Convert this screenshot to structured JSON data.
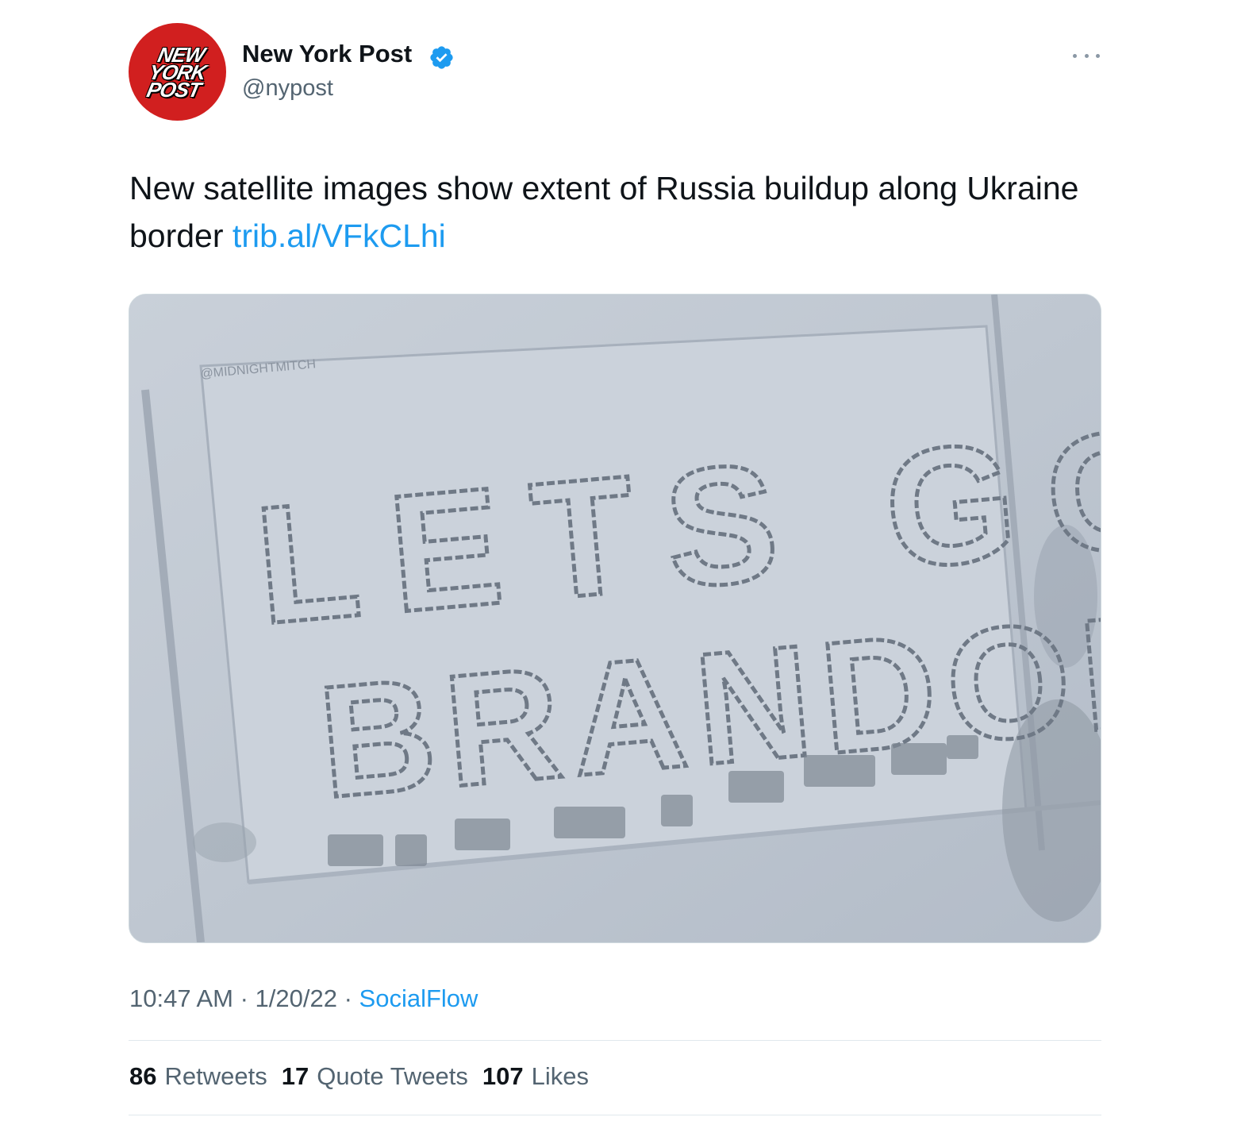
{
  "author": {
    "name": "New York Post",
    "handle": "@nypost",
    "verified": true,
    "avatar_logo_lines": [
      "NEW",
      "YORK",
      "POST"
    ],
    "avatar_color": "#d11f1f"
  },
  "tweet": {
    "text": "New satellite images show extent of Russia buildup along Ukraine border ",
    "link": "trib.al/VFkCLhi"
  },
  "media": {
    "watermark": "@MIDNIGHTMITCH",
    "vehicle_text_line_1": "LETS GO",
    "vehicle_text_line_2": "BRANDON"
  },
  "meta": {
    "time": "10:47 AM",
    "sep1": " · ",
    "date": "1/20/22",
    "sep2": " · ",
    "source": "SocialFlow"
  },
  "stats": {
    "retweets_count": "86",
    "retweets_label": "Retweets",
    "quote_count": "17",
    "quote_label": "Quote Tweets",
    "likes_count": "107",
    "likes_label": "Likes"
  },
  "colors": {
    "link": "#1d9bf0",
    "secondary_text": "#536471",
    "primary_text": "#0f1419"
  },
  "icons": {
    "verified": "verified-badge-icon",
    "more": "more-dots-icon"
  }
}
